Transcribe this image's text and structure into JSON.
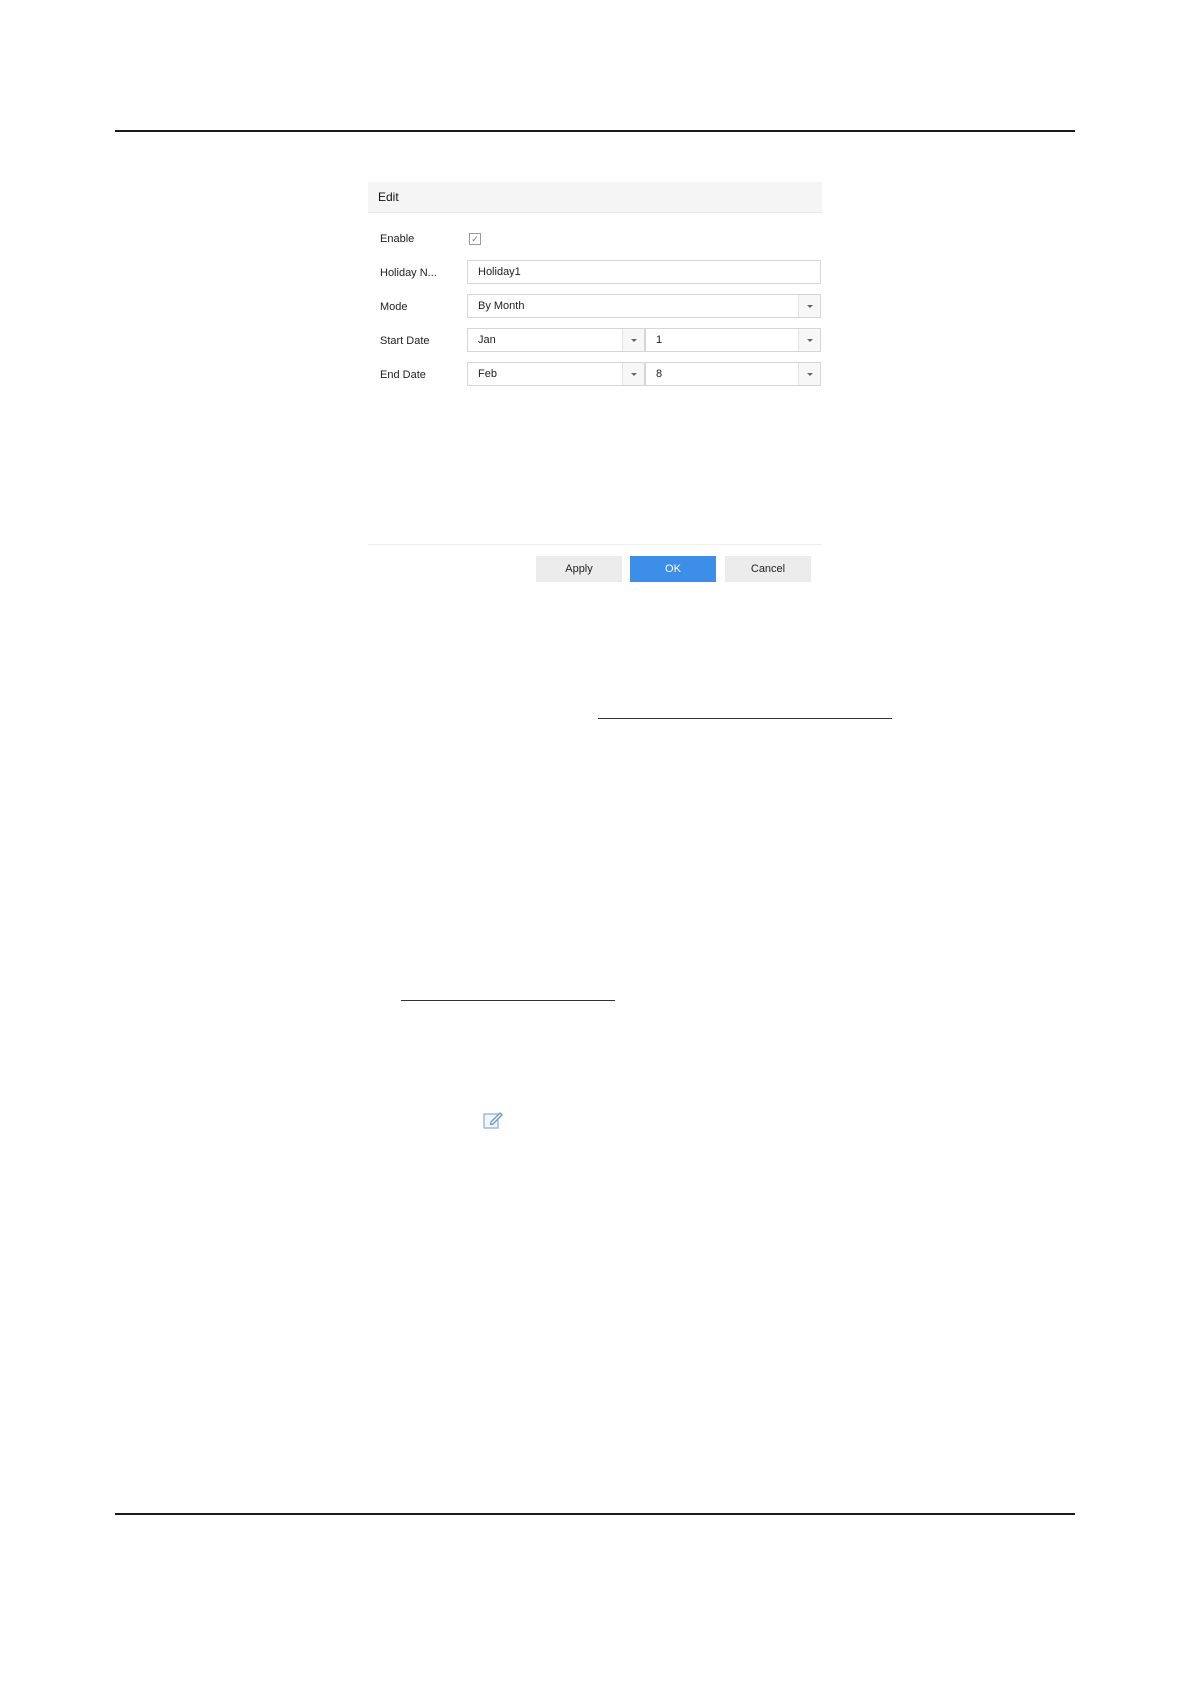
{
  "dialog": {
    "title": "Edit",
    "enable": {
      "label": "Enable",
      "checked": true
    },
    "holiday_name": {
      "label": "Holiday N...",
      "value": "Holiday1"
    },
    "mode": {
      "label": "Mode",
      "value": "By Month"
    },
    "start_date": {
      "label": "Start Date",
      "month": "Jan",
      "day": "1"
    },
    "end_date": {
      "label": "End Date",
      "month": "Feb",
      "day": "8"
    },
    "buttons": {
      "apply": "Apply",
      "ok": "OK",
      "cancel": "Cancel"
    }
  },
  "colors": {
    "primary_button": "#3d8ee8",
    "header_bg": "#f5f5f5"
  },
  "icons": {
    "checkbox": "check-icon",
    "dropdown": "chevron-down-icon",
    "edit": "edit-icon"
  }
}
